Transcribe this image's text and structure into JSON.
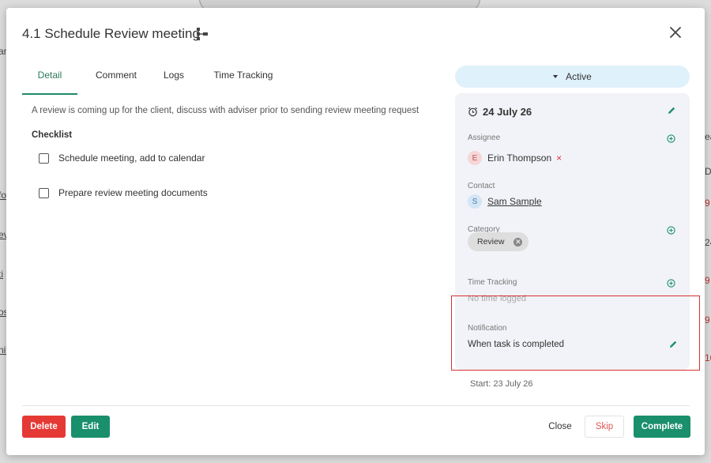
{
  "background_fragments": [
    {
      "text": "am",
      "name": "bg-frag-am"
    },
    {
      "text": "fo",
      "name": "bg-frag-fo"
    },
    {
      "text": "ev",
      "name": "bg-frag-ev"
    },
    {
      "text": "ti",
      "name": "bg-frag-ti"
    },
    {
      "text": "os",
      "name": "bg-frag-os"
    },
    {
      "text": "nit",
      "name": "bg-frag-nit"
    },
    {
      "text": "ea",
      "name": "bg-frag-ea"
    },
    {
      "text": "Do",
      "name": "bg-frag-do"
    },
    {
      "text": "9",
      "name": "bg-frag-9a"
    },
    {
      "text": "24",
      "name": "bg-frag-24"
    },
    {
      "text": "9",
      "name": "bg-frag-9b"
    },
    {
      "text": "9",
      "name": "bg-frag-9c"
    },
    {
      "text": "10",
      "name": "bg-frag-10"
    }
  ],
  "modal": {
    "title": "4.1 Schedule Review meeting",
    "tabs": [
      "Detail",
      "Comment",
      "Logs",
      "Time Tracking"
    ],
    "active_tab": "Detail",
    "description": "A review is coming up for the client, discuss with adviser prior to sending review meeting request",
    "checklist_heading": "Checklist",
    "checklist": [
      {
        "label": "Schedule meeting, add to calendar",
        "checked": false
      },
      {
        "label": "Prepare review meeting documents",
        "checked": false
      }
    ]
  },
  "side": {
    "status": "Active",
    "due_date": "24 July 26",
    "assignee_label": "Assignee",
    "assignee": {
      "initial": "E",
      "name": "Erin Thompson",
      "remove": "×"
    },
    "contact_label": "Contact",
    "contact": {
      "initial": "S",
      "name": "Sam Sample"
    },
    "category_label": "Category",
    "category": "Review",
    "time_tracking_label": "Time Tracking",
    "time_tracking_value": "No time logged",
    "notification_label": "Notification",
    "notification_value": "When task is completed",
    "start": "Start: 23 July 26"
  },
  "footer": {
    "delete": "Delete",
    "edit": "Edit",
    "close": "Close",
    "skip": "Skip",
    "complete": "Complete"
  },
  "colors": {
    "accent_green": "#1a8f6b",
    "danger_red": "#e53935",
    "status_bg": "#dff1fb",
    "panel_bg": "#f1f3f8",
    "highlight": "#d93030"
  },
  "icons": {
    "hierarchy": "hierarchy-icon",
    "close": "close-icon",
    "alarm": "alarm-clock-icon",
    "edit": "pencil-icon",
    "add": "plus-circle-icon",
    "caret": "caret-down-icon",
    "chip_remove": "remove-chip-icon"
  }
}
